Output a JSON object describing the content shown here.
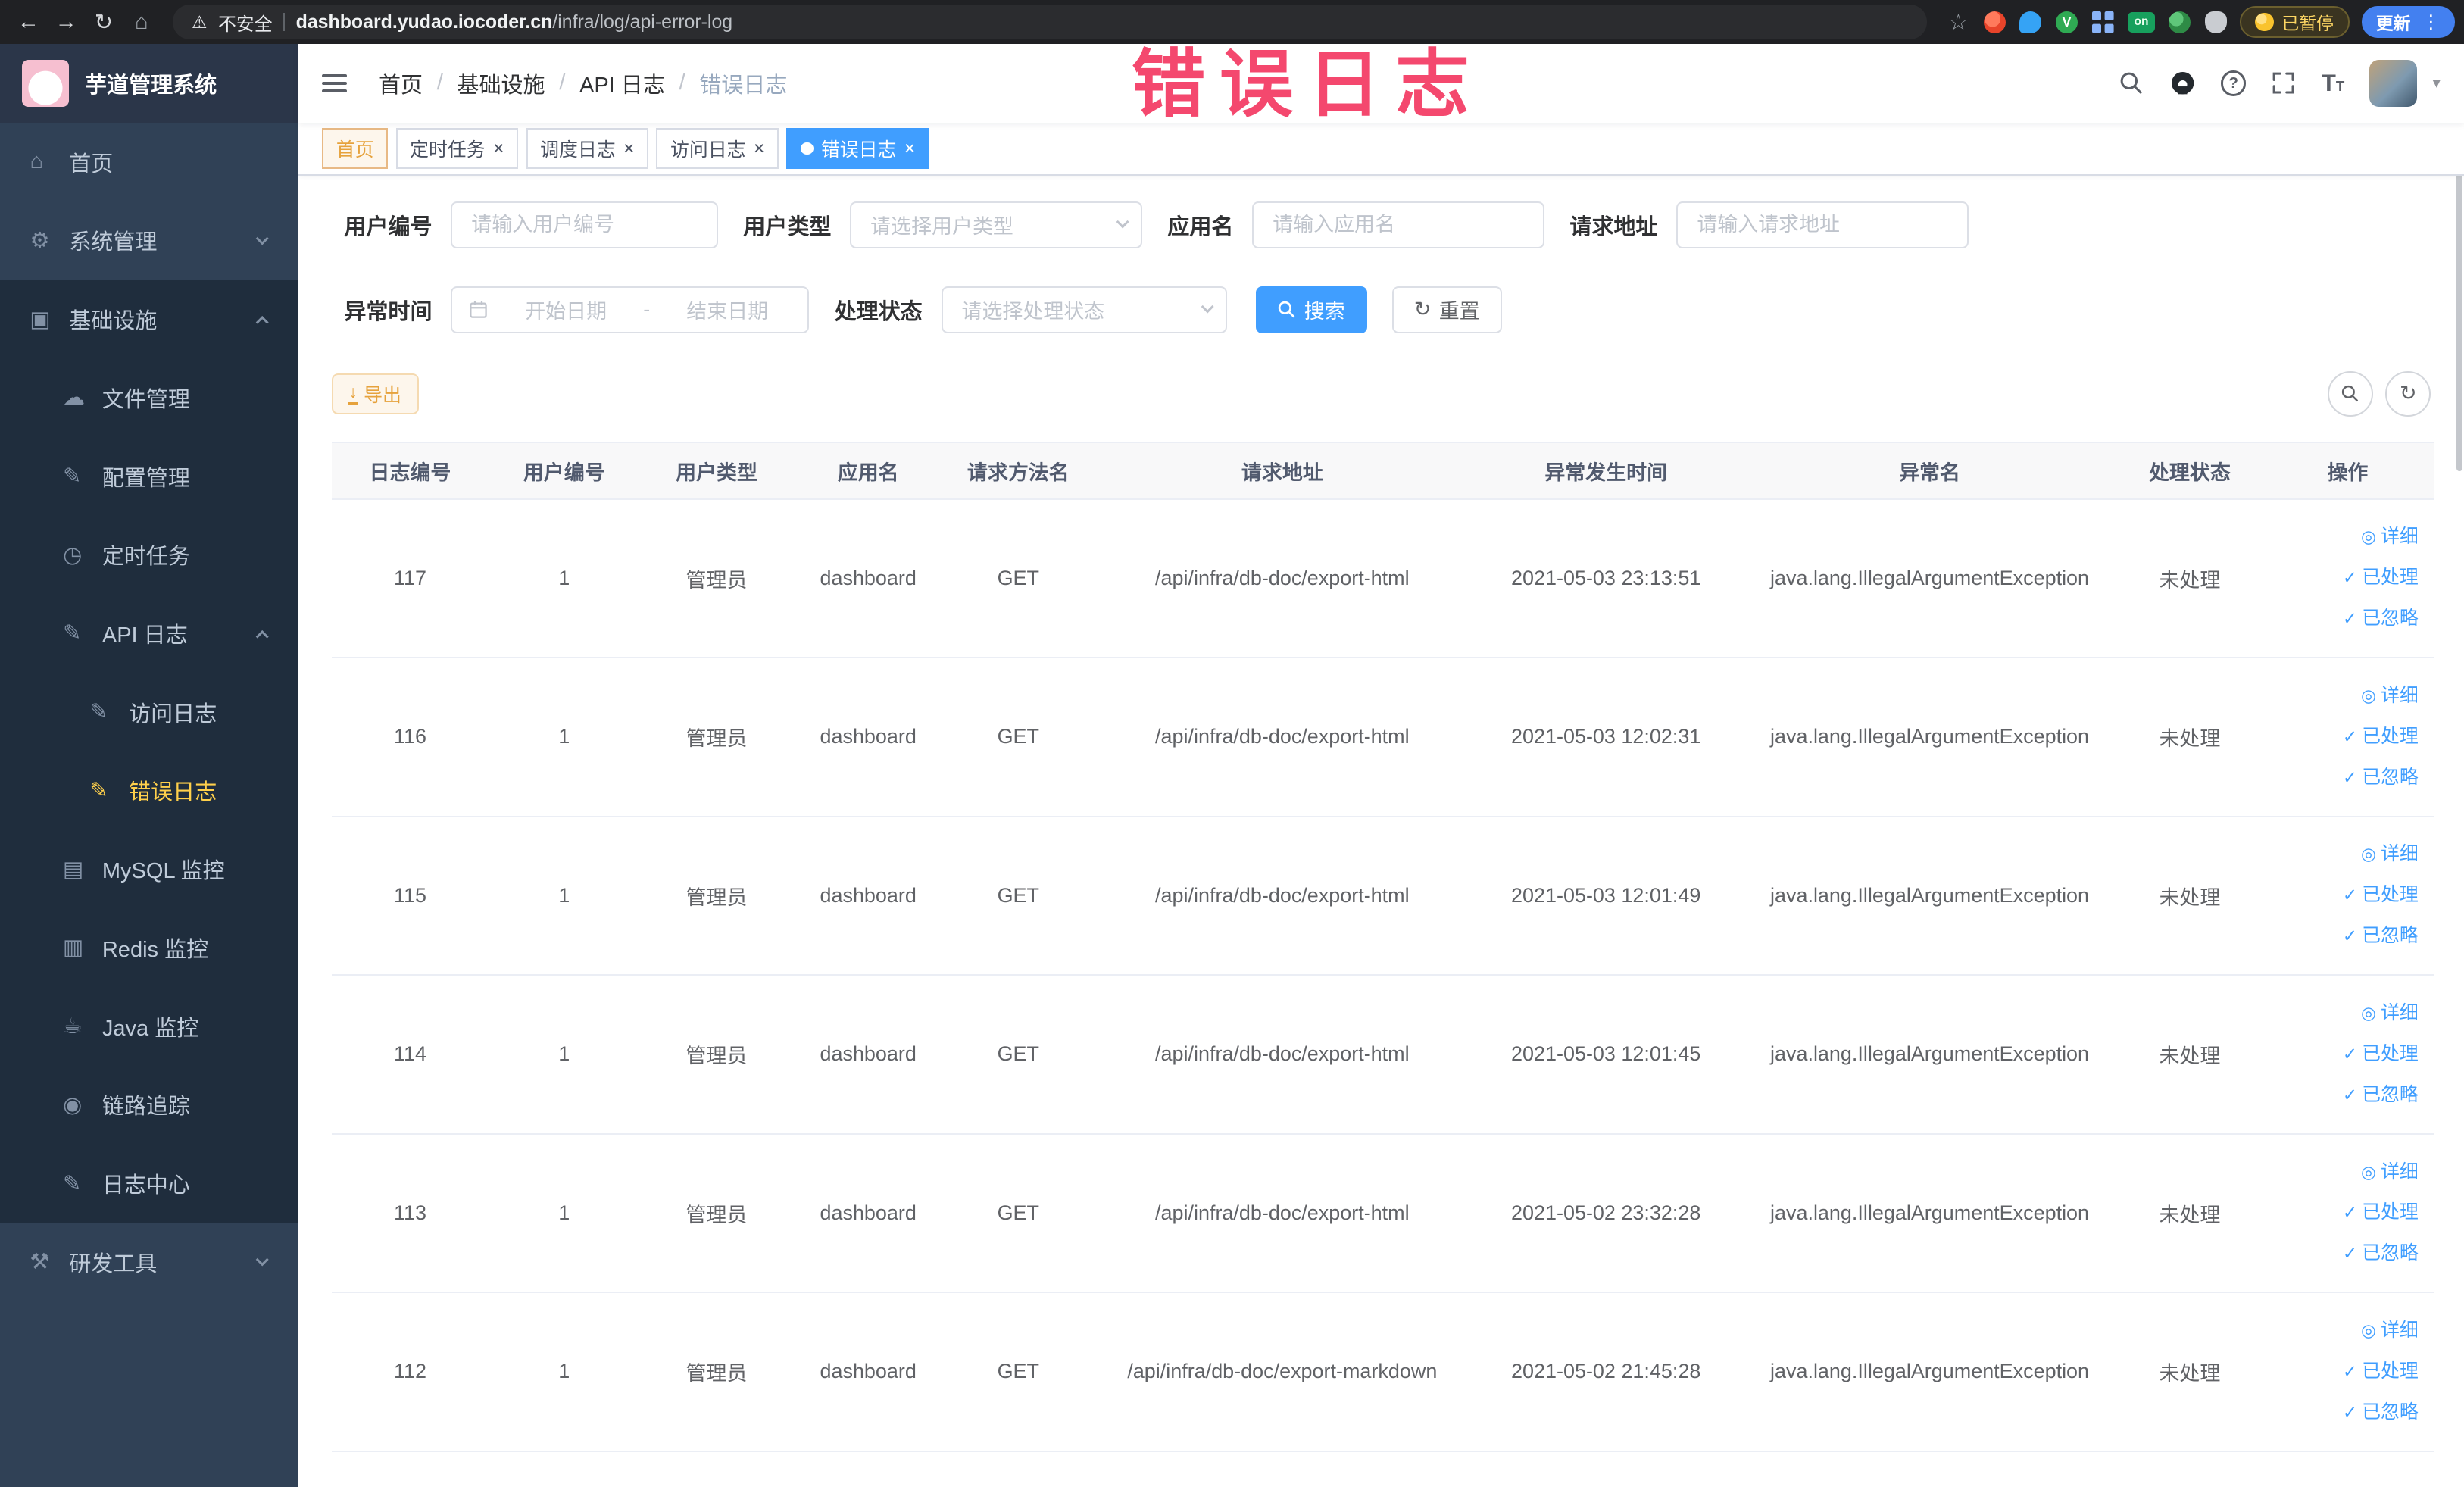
{
  "browser": {
    "security_label": "不安全",
    "url_domain": "dashboard.yudao.iocoder.cn",
    "url_path": "/infra/log/api-error-log",
    "paused_label": "已暂停",
    "update_label": "更新",
    "ext_v_label": "V",
    "ext_on_label": "on"
  },
  "annotation": {
    "text": "错误日志"
  },
  "sidebar": {
    "logo_title": "芋道管理系统",
    "menu": [
      {
        "key": "home",
        "label": "首页",
        "icon": "menu-home-icon",
        "level": 1
      },
      {
        "key": "system",
        "label": "系统管理",
        "icon": "menu-gear-icon",
        "level": 1,
        "arrow": "down"
      },
      {
        "key": "infra",
        "label": "基础设施",
        "icon": "menu-infra-icon",
        "level": 1,
        "arrow": "up",
        "open": true
      },
      {
        "key": "file",
        "label": "文件管理",
        "icon": "menu-file-icon",
        "level": 2
      },
      {
        "key": "config",
        "label": "配置管理",
        "icon": "menu-config-icon",
        "level": 2
      },
      {
        "key": "job",
        "label": "定时任务",
        "icon": "menu-job-icon",
        "level": 2
      },
      {
        "key": "api-log",
        "label": "API 日志",
        "icon": "menu-log-icon",
        "level": 2,
        "arrow": "up",
        "open": true
      },
      {
        "key": "access-log",
        "label": "访问日志",
        "icon": "menu-config-icon",
        "level": 3
      },
      {
        "key": "error-log",
        "label": "错误日志",
        "icon": "menu-config-icon",
        "level": 3,
        "active": true
      },
      {
        "key": "mysql",
        "label": "MySQL 监控",
        "icon": "menu-mysql-icon",
        "level": 2
      },
      {
        "key": "redis",
        "label": "Redis 监控",
        "icon": "menu-redis-icon",
        "level": 2
      },
      {
        "key": "java",
        "label": "Java 监控",
        "icon": "menu-java-icon",
        "level": 2
      },
      {
        "key": "trace",
        "label": "链路追踪",
        "icon": "menu-trace-icon",
        "level": 2
      },
      {
        "key": "log-center",
        "label": "日志中心",
        "icon": "menu-config-icon",
        "level": 2
      },
      {
        "key": "dev-tools",
        "label": "研发工具",
        "icon": "menu-tools-icon",
        "level": 1,
        "arrow": "down"
      }
    ]
  },
  "navbar": {
    "breadcrumb": [
      "首页",
      "基础设施",
      "API 日志",
      "错误日志"
    ],
    "breadcrumb_separator": "/"
  },
  "tags": [
    {
      "label": "首页",
      "closable": false,
      "active": false,
      "affix": true
    },
    {
      "label": "定时任务",
      "closable": true,
      "active": false
    },
    {
      "label": "调度日志",
      "closable": true,
      "active": false
    },
    {
      "label": "访问日志",
      "closable": true,
      "active": false
    },
    {
      "label": "错误日志",
      "closable": true,
      "active": true
    }
  ],
  "filters": {
    "user_id": {
      "label": "用户编号",
      "placeholder": "请输入用户编号"
    },
    "user_type": {
      "label": "用户类型",
      "placeholder": "请选择用户类型"
    },
    "app_name": {
      "label": "应用名",
      "placeholder": "请输入应用名"
    },
    "request_url": {
      "label": "请求地址",
      "placeholder": "请输入请求地址"
    },
    "exception_time": {
      "label": "异常时间",
      "start_placeholder": "开始日期",
      "separator": "-",
      "end_placeholder": "结束日期"
    },
    "process_status": {
      "label": "处理状态",
      "placeholder": "请选择处理状态"
    },
    "search_label": "搜索",
    "reset_label": "重置"
  },
  "toolbar": {
    "export_label": "导出"
  },
  "table": {
    "columns": [
      "日志编号",
      "用户编号",
      "用户类型",
      "应用名",
      "请求方法名",
      "请求地址",
      "异常发生时间",
      "异常名",
      "处理状态",
      "操作"
    ],
    "row_keys": [
      "log-id",
      "user-id",
      "user-type",
      "app-name",
      "request-method",
      "request-url",
      "exception-time",
      "exception-name",
      "process-status"
    ],
    "action_labels": [
      "详细",
      "已处理",
      "已忽略"
    ],
    "action_names": [
      "detail-link",
      "processed-link",
      "ignored-link"
    ],
    "rows": [
      [
        "117",
        "1",
        "管理员",
        "dashboard",
        "GET",
        "/api/infra/db-doc/export-html",
        "2021-05-03 23:13:51",
        "java.lang.IllegalArgumentException",
        "未处理"
      ],
      [
        "116",
        "1",
        "管理员",
        "dashboard",
        "GET",
        "/api/infra/db-doc/export-html",
        "2021-05-03 12:02:31",
        "java.lang.IllegalArgumentException",
        "未处理"
      ],
      [
        "115",
        "1",
        "管理员",
        "dashboard",
        "GET",
        "/api/infra/db-doc/export-html",
        "2021-05-03 12:01:49",
        "java.lang.IllegalArgumentException",
        "未处理"
      ],
      [
        "114",
        "1",
        "管理员",
        "dashboard",
        "GET",
        "/api/infra/db-doc/export-html",
        "2021-05-03 12:01:45",
        "java.lang.IllegalArgumentException",
        "未处理"
      ],
      [
        "113",
        "1",
        "管理员",
        "dashboard",
        "GET",
        "/api/infra/db-doc/export-html",
        "2021-05-02 23:32:28",
        "java.lang.IllegalArgumentException",
        "未处理"
      ],
      [
        "112",
        "1",
        "管理员",
        "dashboard",
        "GET",
        "/api/infra/db-doc/export-markdown",
        "2021-05-02 21:45:28",
        "java.lang.IllegalArgumentException",
        "未处理"
      ]
    ]
  },
  "icon_glyphs": {
    "back-icon": "←",
    "forward-icon": "→",
    "reload-icon": "↻",
    "home-icon": "⌂",
    "warning-icon": "⚠",
    "star-icon": "☆",
    "menu-dots-icon": "⋮",
    "close-icon": "×",
    "check-icon": "✓",
    "view-icon": "◎",
    "question-icon": "?",
    "letter-T": "T",
    "caret-down-icon": "▾",
    "refresh-icon": "↻",
    "download-icon": "↓",
    "menu-home-icon": "⌂",
    "menu-gear-icon": "⚙",
    "menu-infra-icon": "▣",
    "menu-file-icon": "☁",
    "menu-config-icon": "✎",
    "menu-job-icon": "◷",
    "menu-log-icon": "✎",
    "menu-mysql-icon": "▤",
    "menu-redis-icon": "▥",
    "menu-java-icon": "☕",
    "menu-trace-icon": "◉",
    "menu-tools-icon": "⚒"
  },
  "colors": {
    "accent": "#409eff",
    "sidebar_bg": "#304156",
    "sidebar_sub_bg": "#1f2d3d",
    "sidebar_active_text": "#ffd04b",
    "warning": "#e6a23c",
    "annotation": "#f4486e",
    "active_tag_bg": "#409eff"
  }
}
